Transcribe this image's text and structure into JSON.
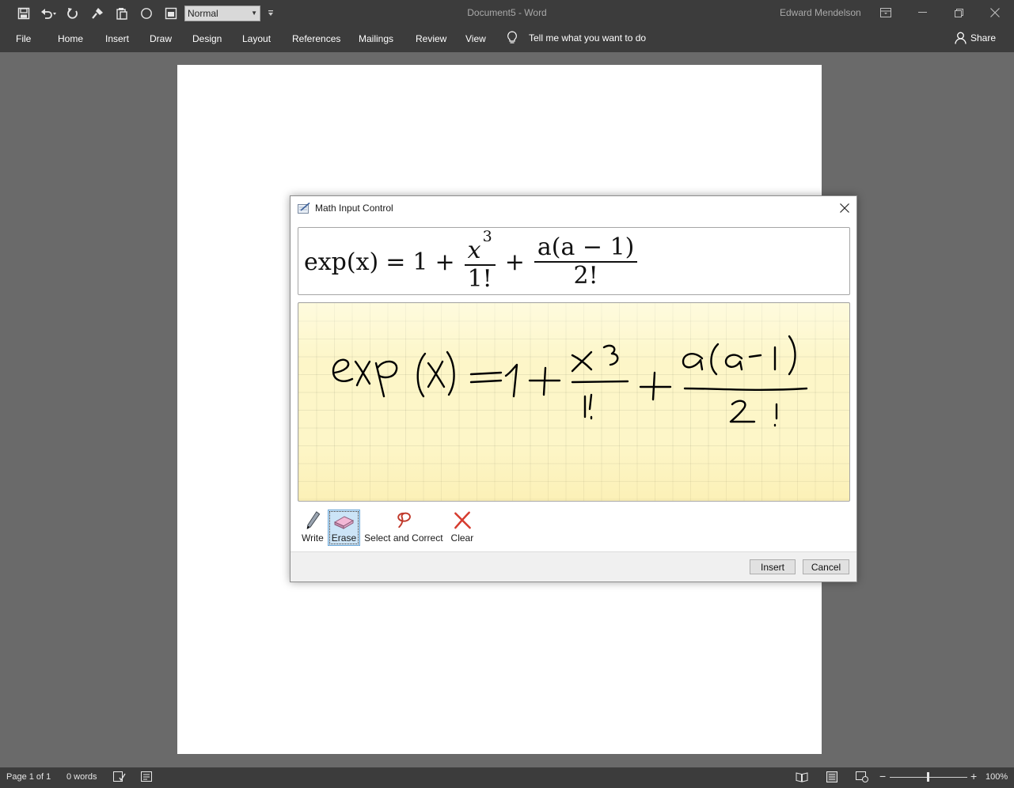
{
  "window": {
    "title": "Document5  -  Word",
    "user": "Edward Mendelson"
  },
  "qat": {
    "icons": [
      "save-icon",
      "undo-icon",
      "redo-icon",
      "format-painter-icon",
      "paste-icon",
      "circle-shape-icon",
      "frame-icon"
    ],
    "style_value": "Normal"
  },
  "ribbon": {
    "tabs": [
      "File",
      "Home",
      "Insert",
      "Draw",
      "Design",
      "Layout",
      "References",
      "Mailings",
      "Review",
      "View"
    ],
    "tell_me": "Tell me what you want to do",
    "share": "Share"
  },
  "dialog": {
    "title": "Math Input Control",
    "preview": {
      "lhs": "exp(x)",
      "equals": "=",
      "one": "1",
      "plus": "+",
      "frac1_num_base": "x",
      "frac1_num_exp": "3",
      "frac1_den": "1!",
      "frac2_num": "a(a − 1)",
      "frac2_den": "2!"
    },
    "tools": [
      {
        "label": "Write",
        "icon": "pen-icon",
        "active": false
      },
      {
        "label": "Erase",
        "icon": "eraser-icon",
        "active": true
      },
      {
        "label": "Select and Correct",
        "icon": "lasso-icon",
        "active": false
      },
      {
        "label": "Clear",
        "icon": "clear-x-icon",
        "active": false
      }
    ],
    "insert_label": "Insert",
    "cancel_label": "Cancel"
  },
  "statusbar": {
    "page": "Page 1 of 1",
    "words": "0 words",
    "zoom": "100%",
    "zoom_percent": 100
  },
  "colors": {
    "chrome": "#3c3c3c",
    "canvas": "#6a6a6a",
    "ink_pad": "#fdf6c8",
    "ink": "#000000",
    "active_tool": "#cce4f7"
  }
}
